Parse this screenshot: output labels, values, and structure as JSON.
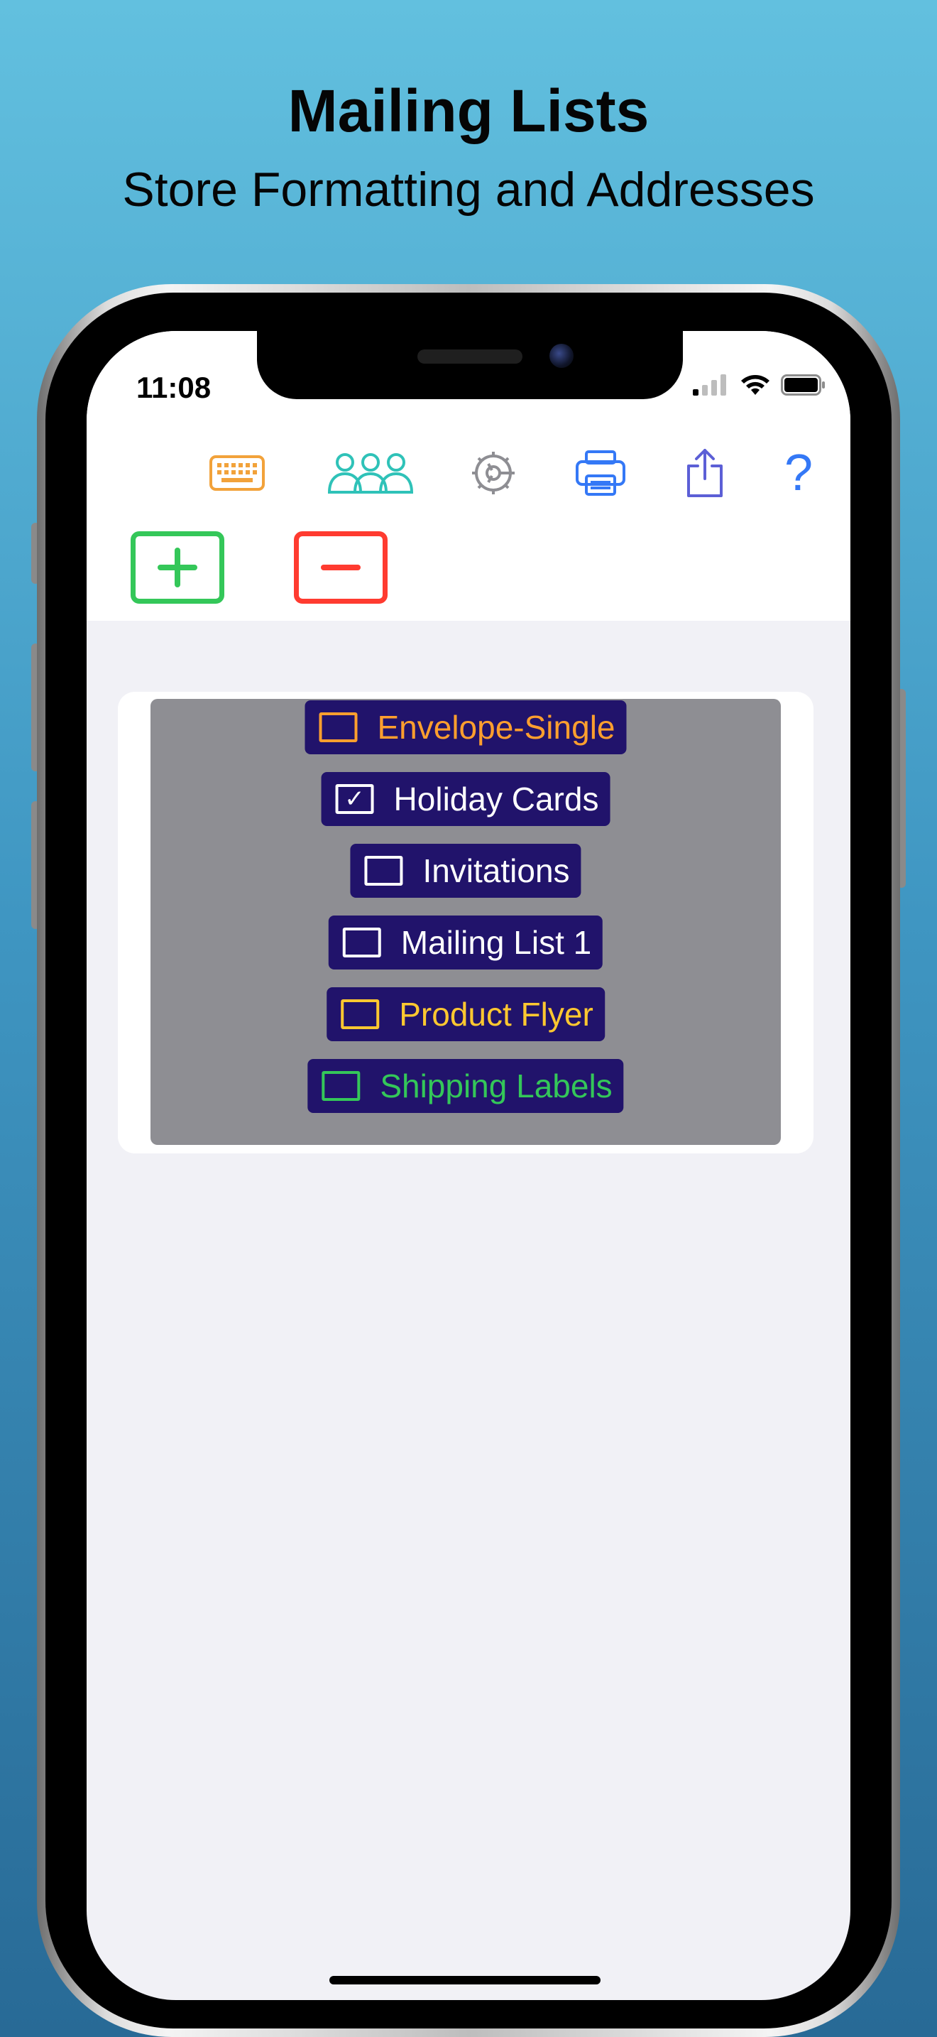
{
  "promo": {
    "title": "Mailing Lists",
    "subtitle": "Store Formatting and Addresses"
  },
  "status_bar": {
    "time": "11:08",
    "icons": [
      "cellular-signal-icon",
      "wifi-icon",
      "battery-icon"
    ]
  },
  "toolbar": {
    "icons": [
      {
        "name": "keyboard-icon",
        "color": "#f2a23a"
      },
      {
        "name": "people-icon",
        "color": "#2fc2b8"
      },
      {
        "name": "gear-icon",
        "color": "#8e8e93"
      },
      {
        "name": "printer-icon",
        "color": "#3478f6"
      },
      {
        "name": "share-icon",
        "color": "#5c5fd6"
      },
      {
        "name": "help-icon",
        "label": "?",
        "color": "#3478f6"
      }
    ]
  },
  "actions": {
    "add": {
      "icon": "plus-icon",
      "color": "#34c759"
    },
    "remove": {
      "icon": "minus-icon",
      "color": "#ff3b30"
    }
  },
  "lists": {
    "items": [
      {
        "label": "Envelope-Single",
        "checked": false,
        "color": "#ff9f2e"
      },
      {
        "label": "Holiday Cards",
        "checked": true,
        "color": "#ffffff"
      },
      {
        "label": "Invitations",
        "checked": false,
        "color": "#ffffff"
      },
      {
        "label": "Mailing List 1",
        "checked": false,
        "color": "#ffffff"
      },
      {
        "label": "Product Flyer",
        "checked": false,
        "color": "#ffc830"
      },
      {
        "label": "Shipping Labels",
        "checked": false,
        "color": "#34c759"
      }
    ],
    "check_mark": "✓"
  }
}
